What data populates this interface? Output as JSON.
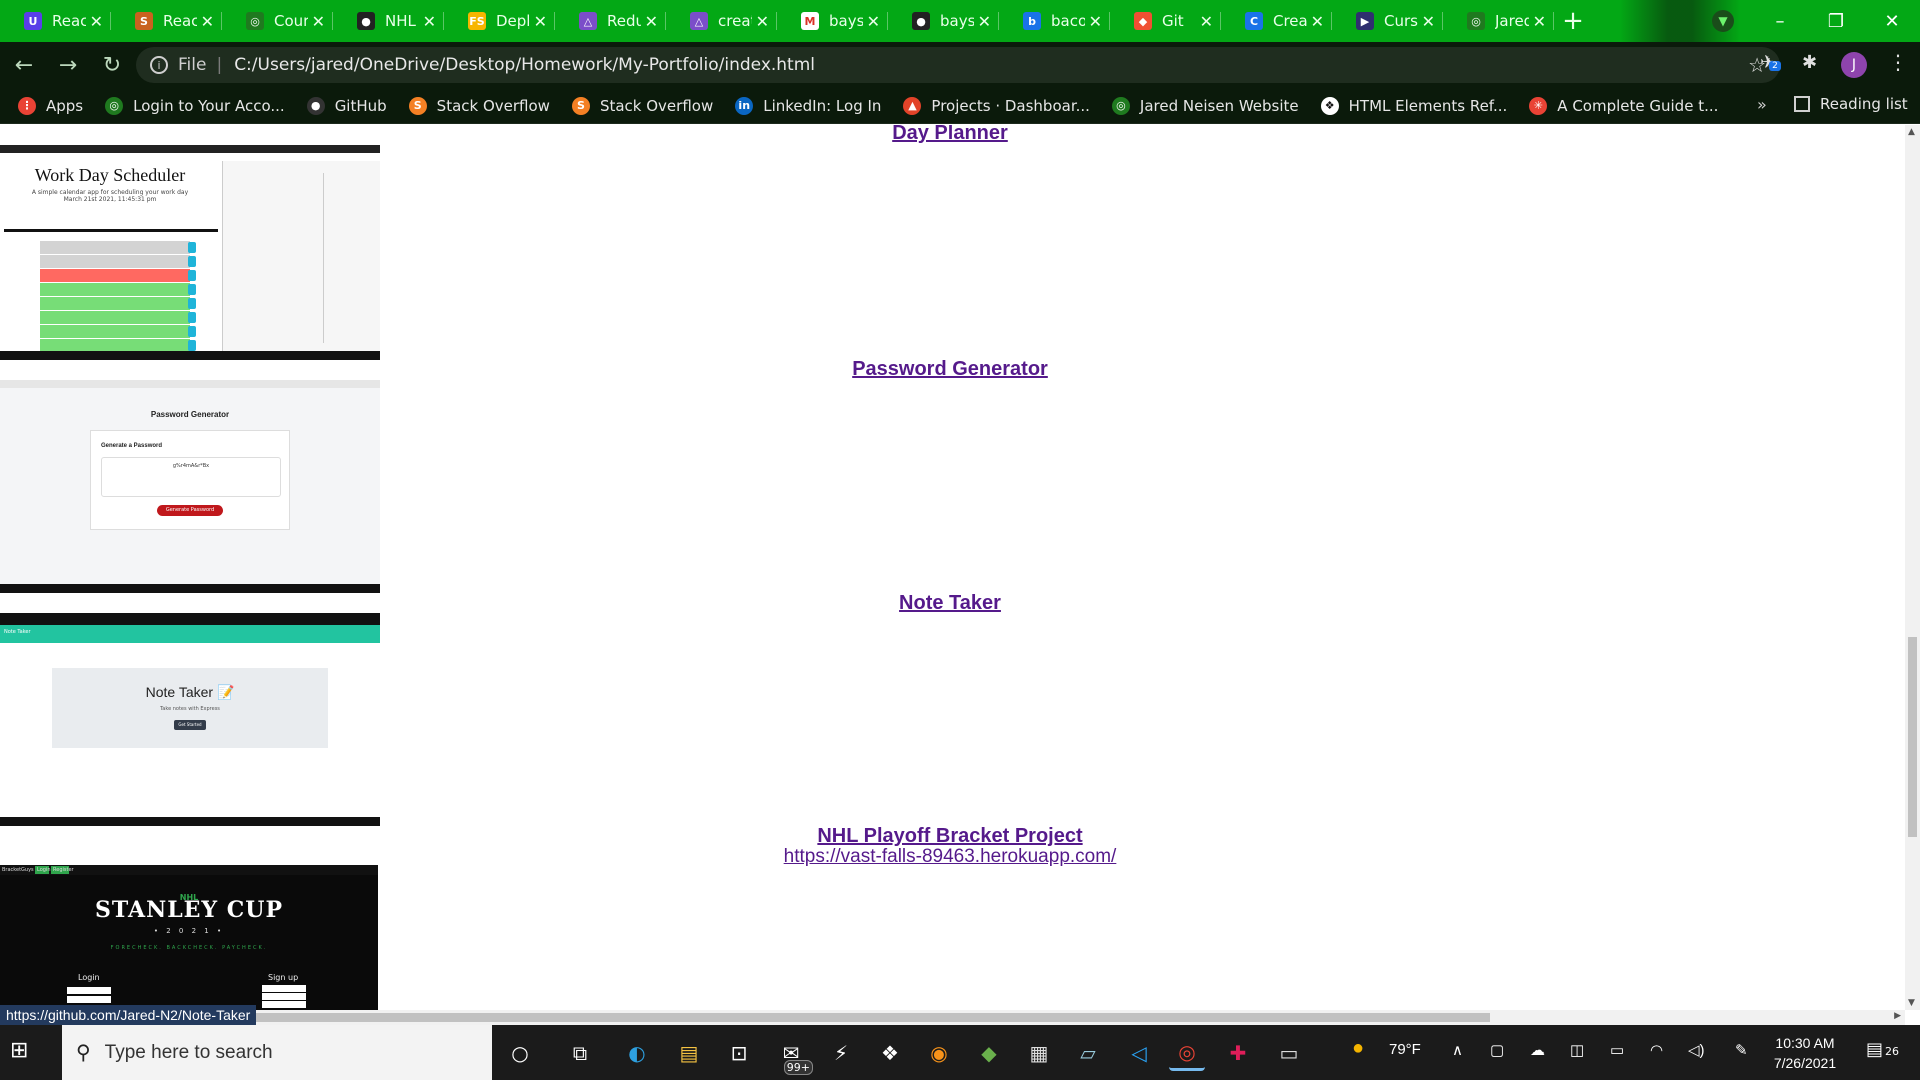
{
  "tabs": [
    {
      "title": "React",
      "fav_color": "#5a3ee8",
      "fav_glyph": "U"
    },
    {
      "title": "React",
      "fav_color": "#c8621f",
      "fav_glyph": "S"
    },
    {
      "title": "Cour",
      "fav_color": "#1f7a1f",
      "fav_glyph": "◎"
    },
    {
      "title": "NHL",
      "fav_color": "#222222",
      "fav_glyph": "●"
    },
    {
      "title": "Depl",
      "fav_color": "#f7b500",
      "fav_glyph": "FS"
    },
    {
      "title": "Redu",
      "fav_color": "#7b4ec9",
      "fav_glyph": "△"
    },
    {
      "title": "creat",
      "fav_color": "#7b4ec9",
      "fav_glyph": "△"
    },
    {
      "title": "bays",
      "fav_color": "#ffffff",
      "fav_glyph": "M"
    },
    {
      "title": "bays",
      "fav_color": "#222222",
      "fav_glyph": "●"
    },
    {
      "title": "baco",
      "fav_color": "#1a73e8",
      "fav_glyph": "b"
    },
    {
      "title": "Git",
      "fav_color": "#f05033",
      "fav_glyph": "◆"
    },
    {
      "title": "Crea",
      "fav_color": "#1a73e8",
      "fav_glyph": "C"
    },
    {
      "title": "Curs",
      "fav_color": "#2f2f6f",
      "fav_glyph": "▶"
    },
    {
      "title": "Jared",
      "fav_color": "#1f7a1f",
      "fav_glyph": "◎"
    }
  ],
  "window": {
    "minimize": "–",
    "restore": "❐",
    "close": "✕",
    "new_tab": "+"
  },
  "address": {
    "scheme_label": "File",
    "url": "C:/Users/jared/OneDrive/Desktop/Homework/My-Portfolio/index.html",
    "info_icon": "i",
    "star_icon": "☆"
  },
  "profile": {
    "initial": "J",
    "badge": "2"
  },
  "bookmarks": [
    {
      "label": "Apps",
      "color": "#e94335",
      "glyph": "⋮"
    },
    {
      "label": "Login to Your Acco...",
      "color": "#1f7a1f",
      "glyph": "◎"
    },
    {
      "label": "GitHub",
      "color": "#333333",
      "glyph": "●"
    },
    {
      "label": "Stack Overflow",
      "color": "#f48024",
      "glyph": "S"
    },
    {
      "label": "Stack Overflow",
      "color": "#f48024",
      "glyph": "S"
    },
    {
      "label": "LinkedIn: Log In",
      "color": "#0a66c2",
      "glyph": "in"
    },
    {
      "label": "Projects · Dashboar...",
      "color": "#e24329",
      "glyph": "▲"
    },
    {
      "label": "Jared Neisen Website",
      "color": "#1f7a1f",
      "glyph": "◎"
    },
    {
      "label": "HTML Elements Ref...",
      "color": "#ffffff",
      "glyph": "❖"
    },
    {
      "label": "A Complete Guide t...",
      "color": "#e94335",
      "glyph": "✳"
    }
  ],
  "bookmarks_overflow": "»",
  "reading_list": "Reading list",
  "projects": [
    {
      "title": "Day Planner"
    },
    {
      "title": "Password Generator"
    },
    {
      "title": "Note Taker"
    },
    {
      "title": "NHL Playoff Bracket Project",
      "url": "https://vast-falls-89463.herokuapp.com/"
    }
  ],
  "thumbs": {
    "day_planner": {
      "title": "Work Day Scheduler",
      "subtitle": "A simple calendar app for scheduling your work day",
      "date": "March 21st 2021, 11:45:31 pm"
    },
    "password": {
      "title": "Password Generator",
      "card_title": "Generate a Password",
      "password": "g%r4mA&r*Bx",
      "button": "Generate Password"
    },
    "note_taker": {
      "nav": "Note Taker",
      "title": "Note Taker 📝",
      "subtitle": "Take notes with Express",
      "button": "Get Started"
    },
    "nhl": {
      "nav_brand": "BracketGuys",
      "nav_login": "Login",
      "nav_register": "Register",
      "nhl": "NHL",
      "title": "STANLEY CUP",
      "year": "• 2 0 2 1 •",
      "tagline": "FORECHECK. BACKCHECK. PAYCHECK.",
      "login": "Login",
      "signup": "Sign up"
    }
  },
  "status_url": "https://github.com/Jared-N2/Note-Taker",
  "taskbar": {
    "search_placeholder": "Type here to search",
    "weather": "79°F",
    "time": "10:30 AM",
    "date": "7/26/2021",
    "badge": "99+",
    "notif_count": "26"
  }
}
